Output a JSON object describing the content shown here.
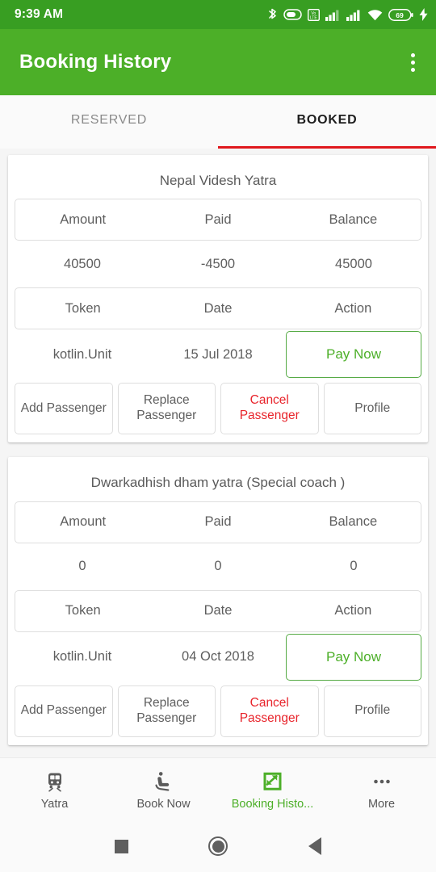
{
  "status_bar": {
    "time": "9:39 AM",
    "battery_percent": "69",
    "icons": [
      "bluetooth-icon",
      "dnd-icon",
      "volte-icon",
      "signal-bars-icon",
      "signal-bars-icon",
      "wifi-icon",
      "battery-icon",
      "charging-bolt-icon"
    ],
    "background_color": "#389e22"
  },
  "app_bar": {
    "title": "Booking History",
    "overflow_label": "more-options",
    "background_color": "#4caf28"
  },
  "tabs": {
    "items": [
      {
        "label": "RESERVED",
        "active": false
      },
      {
        "label": "BOOKED",
        "active": true
      }
    ],
    "indicator_color": "#e0181d"
  },
  "cards": [
    {
      "title": "Nepal Videsh Yatra",
      "summary_headers": [
        "Amount",
        "Paid",
        "Balance"
      ],
      "summary_values": [
        "40500",
        "-4500",
        "45000"
      ],
      "detail_headers": [
        "Token",
        "Date",
        "Action"
      ],
      "token": "kotlin.Unit",
      "date": "15 Jul 2018",
      "pay_label": "Pay Now",
      "actions": [
        {
          "label": "Add Passenger",
          "danger": false
        },
        {
          "label": "Replace Passenger",
          "danger": false
        },
        {
          "label": "Cancel Passenger",
          "danger": true
        },
        {
          "label": "Profile",
          "danger": false
        }
      ]
    },
    {
      "title": "Dwarkadhish dham yatra (Special coach )",
      "summary_headers": [
        "Amount",
        "Paid",
        "Balance"
      ],
      "summary_values": [
        "0",
        "0",
        "0"
      ],
      "detail_headers": [
        "Token",
        "Date",
        "Action"
      ],
      "token": "kotlin.Unit",
      "date": "04 Oct 2018",
      "pay_label": "Pay Now",
      "actions": [
        {
          "label": "Add Passenger",
          "danger": false
        },
        {
          "label": "Replace Passenger",
          "danger": false
        },
        {
          "label": "Cancel Passenger",
          "danger": true
        },
        {
          "label": "Profile",
          "danger": false
        }
      ]
    }
  ],
  "bottom_nav": {
    "items": [
      {
        "label": "Yatra",
        "icon": "train-icon",
        "active": false
      },
      {
        "label": "Book Now",
        "icon": "seat-icon",
        "active": false
      },
      {
        "label": "Booking Histo...",
        "icon": "booking-history-icon",
        "active": true
      },
      {
        "label": "More",
        "icon": "more-dots-icon",
        "active": false
      }
    ],
    "active_color": "#4caf28"
  },
  "system_nav": {
    "recent_label": "recent-apps",
    "home_label": "home",
    "back_label": "back"
  }
}
